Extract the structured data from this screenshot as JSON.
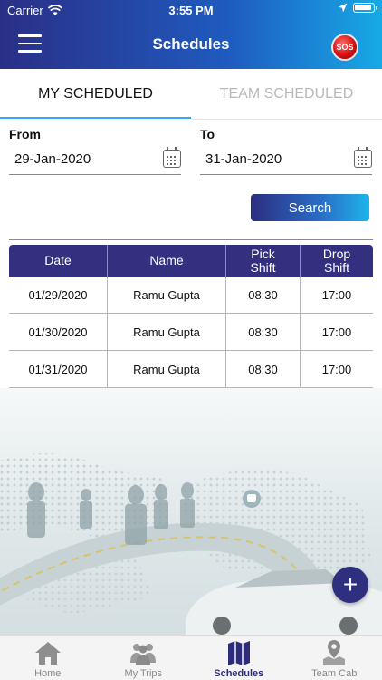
{
  "status_bar": {
    "carrier": "Carrier",
    "time": "3:55 PM"
  },
  "header": {
    "title": "Schedules",
    "sos_label": "SOS"
  },
  "tabs": [
    {
      "label": "MY SCHEDULED",
      "active": true
    },
    {
      "label": "TEAM SCHEDULED",
      "active": false
    }
  ],
  "filters": {
    "from_label": "From",
    "from_value": "29-Jan-2020",
    "to_label": "To",
    "to_value": "31-Jan-2020",
    "search_label": "Search"
  },
  "table": {
    "headers": [
      "Date",
      "Name",
      "Pick\nShift",
      "Drop\nShift"
    ],
    "rows": [
      [
        "01/29/2020",
        "Ramu Gupta",
        "08:30",
        "17:00"
      ],
      [
        "01/30/2020",
        "Ramu Gupta",
        "08:30",
        "17:00"
      ],
      [
        "01/31/2020",
        "Ramu Gupta",
        "08:30",
        "17:00"
      ]
    ]
  },
  "fab_icon": "plus-icon",
  "bottom_nav": [
    {
      "label": "Home",
      "icon": "home-icon",
      "active": false
    },
    {
      "label": "My Trips",
      "icon": "people-icon",
      "active": false
    },
    {
      "label": "Schedules",
      "icon": "map-icon",
      "active": true
    },
    {
      "label": "Team Cab",
      "icon": "map-pin-icon",
      "active": false
    }
  ],
  "colors": {
    "header_start": "#2a2f86",
    "header_end": "#17a9e6",
    "table_header": "#33317f",
    "tab_accent": "#33a7ef",
    "nav_active": "#2d2c7a"
  }
}
